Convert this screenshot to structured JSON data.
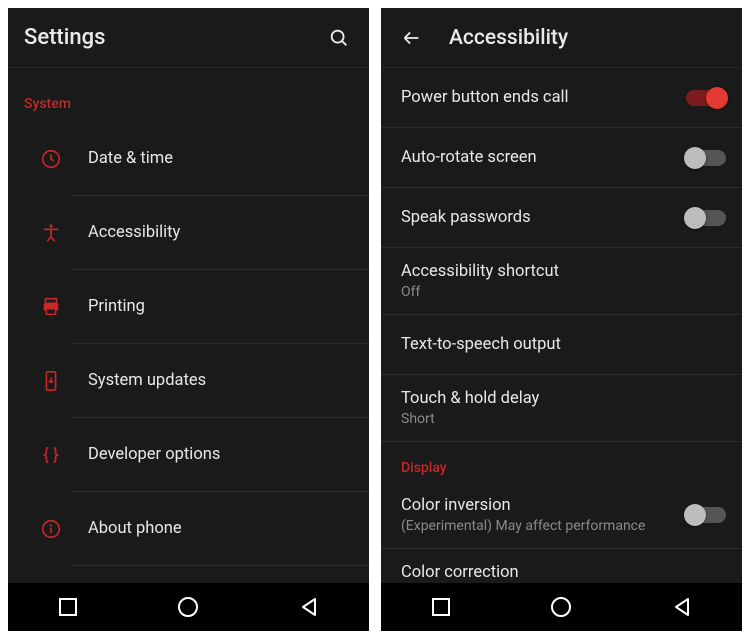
{
  "left": {
    "title": "Settings",
    "section": "System",
    "items": [
      {
        "label": "Date & time"
      },
      {
        "label": "Accessibility"
      },
      {
        "label": "Printing"
      },
      {
        "label": "System updates"
      },
      {
        "label": "Developer options"
      },
      {
        "label": "About phone"
      }
    ]
  },
  "right": {
    "title": "Accessibility",
    "items": [
      {
        "label": "Power button ends call",
        "toggle": true,
        "on": true
      },
      {
        "label": "Auto-rotate screen",
        "toggle": true,
        "on": false
      },
      {
        "label": "Speak passwords",
        "toggle": true,
        "on": false
      },
      {
        "label": "Accessibility shortcut",
        "sub": "Off"
      },
      {
        "label": "Text-to-speech output"
      },
      {
        "label": "Touch & hold delay",
        "sub": "Short"
      }
    ],
    "section2": "Display",
    "items2": [
      {
        "label": "Color inversion",
        "sub": "(Experimental) May affect performance",
        "toggle": true,
        "on": false
      },
      {
        "label": "Color correction"
      }
    ]
  }
}
